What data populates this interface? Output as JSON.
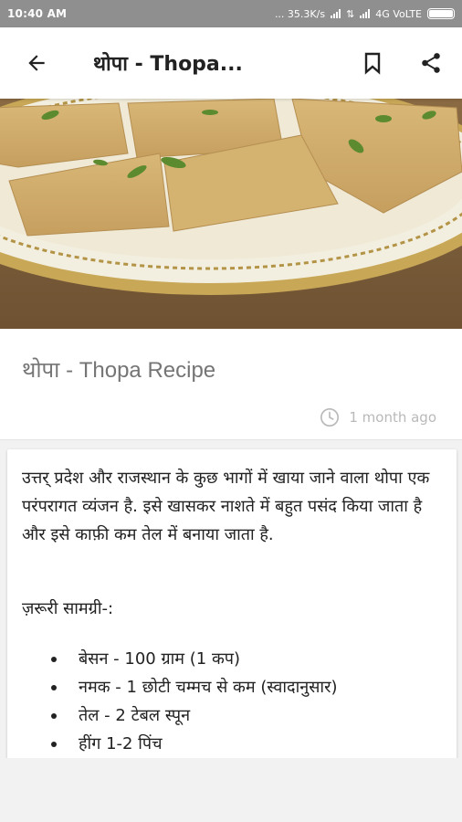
{
  "status_bar": {
    "time": "10:40 AM",
    "speed": "... 35.3K/s",
    "network": "4G VoLTE"
  },
  "app_bar": {
    "title": "थोपा - Thopa...",
    "back_icon": "arrow-back-icon",
    "bookmark_icon": "bookmark-icon",
    "share_icon": "share-icon"
  },
  "hero": {
    "image_alt": "Thopa dish on decorated plate"
  },
  "recipe": {
    "title": "थोपा - Thopa Recipe",
    "posted": "1 month ago",
    "intro": "उत्तर् प्रदेश और राजस्थान के कुछ भागों में खाया जाने वाला थोपा एक परंपरागत व्यंजन है. इसे खासकर नाशते में बहुत पसंद किया जाता है और इसे काफ़ी कम तेल में बनाया जाता है.",
    "ingredients_heading": "ज़रूरी सामग्री-:",
    "ingredients": [
      "बेसन - 100 ग्राम (1 कप)",
      "नमक - 1 छोटी चम्मच से कम (स्वादानुसार)",
      "तेल - 2 टेबल स्पून",
      "हींग 1-2 पिंच"
    ]
  },
  "colors": {
    "status_bar_bg": "#8f8f8f",
    "app_bar_bg": "#ffffff",
    "title_text": "#757575",
    "meta_text": "#b9b9b9"
  }
}
